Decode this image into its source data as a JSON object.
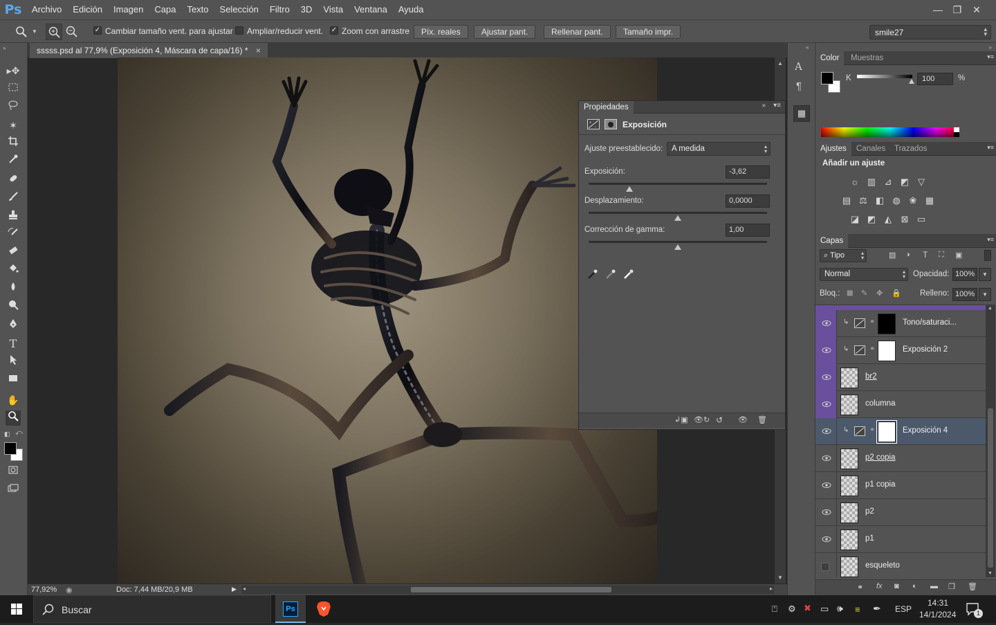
{
  "app": {
    "logo": "Ps"
  },
  "menu": [
    "Archivo",
    "Edición",
    "Imagen",
    "Capa",
    "Texto",
    "Selección",
    "Filtro",
    "3D",
    "Vista",
    "Ventana",
    "Ayuda"
  ],
  "window_controls": {
    "minimize": "—",
    "restore": "❐",
    "close": "✕"
  },
  "options": {
    "resize_windows": {
      "label": "Cambiar tamaño vent. para ajustar",
      "checked": true
    },
    "zoom_all": {
      "label": "Ampliar/reducir vent.",
      "checked": false
    },
    "scrubby_zoom": {
      "label": "Zoom con arrastre",
      "checked": true
    },
    "buttons": [
      "Píx. reales",
      "Ajustar pant.",
      "Rellenar pant.",
      "Tamaño impr."
    ],
    "workspace": "smile27"
  },
  "document": {
    "tab_title": "sssss.psd al 77,9% (Exposición 4, Máscara de capa/16) *",
    "close": "×",
    "zoom": "77,92%",
    "doc_info": "Doc: 7,44 MB/20,9 MB"
  },
  "properties": {
    "panel_title": "Propiedades",
    "adjustment_title": "Exposición",
    "preset_label": "Ajuste preestablecido:",
    "preset_value": "A medida",
    "sliders": [
      {
        "label": "Exposición:",
        "value": "-3,62",
        "position": 0.23
      },
      {
        "label": "Desplazamiento:",
        "value": "0,0000",
        "position": 0.5
      },
      {
        "label": "Corrección de gamma:",
        "value": "1,00",
        "position": 0.5
      }
    ]
  },
  "color_panel": {
    "tabs": [
      "Color",
      "Muestras"
    ],
    "channel": "K",
    "value": "100",
    "unit": "%"
  },
  "adjustments_panel": {
    "tabs": [
      "Ajustes",
      "Canales",
      "Trazados"
    ],
    "heading": "Añadir un ajuste"
  },
  "layers_panel": {
    "tab": "Capas",
    "filter": "Tipo",
    "blend_mode": "Normal",
    "opacity_label": "Opacidad:",
    "opacity": "100%",
    "lock_label": "Bloq.:",
    "fill_label": "Relleno:",
    "fill": "100%",
    "layers": [
      {
        "name": "Tono/saturaci...",
        "visible": true,
        "kind": "adjustment",
        "mask": "black",
        "clipped": true,
        "tint": true
      },
      {
        "name": "Exposición 2",
        "visible": true,
        "kind": "adjustment",
        "mask": "white",
        "clipped": true,
        "tint": true
      },
      {
        "name": "br2",
        "visible": true,
        "kind": "pixel",
        "tint": true,
        "underline": true
      },
      {
        "name": "columna",
        "visible": true,
        "kind": "pixel",
        "tint": true
      },
      {
        "name": "Exposición 4",
        "visible": true,
        "kind": "adjustment",
        "mask": "white",
        "clipped": true,
        "selected": true
      },
      {
        "name": "p2 copia",
        "visible": true,
        "kind": "pixel",
        "underline": true
      },
      {
        "name": "p1 copia",
        "visible": true,
        "kind": "pixel"
      },
      {
        "name": "p2",
        "visible": true,
        "kind": "pixel"
      },
      {
        "name": "p1",
        "visible": true,
        "kind": "pixel"
      },
      {
        "name": "esqueleto",
        "visible": false,
        "kind": "pixel"
      }
    ]
  },
  "taskbar": {
    "search": "Buscar",
    "language": "ESP",
    "time": "14:31",
    "date": "14/1/2024",
    "notifications": "1"
  },
  "colors": {
    "selected_layer": "#4c596b",
    "clip_tint": "#6a4f9c",
    "accent": "#5aa7ef"
  }
}
